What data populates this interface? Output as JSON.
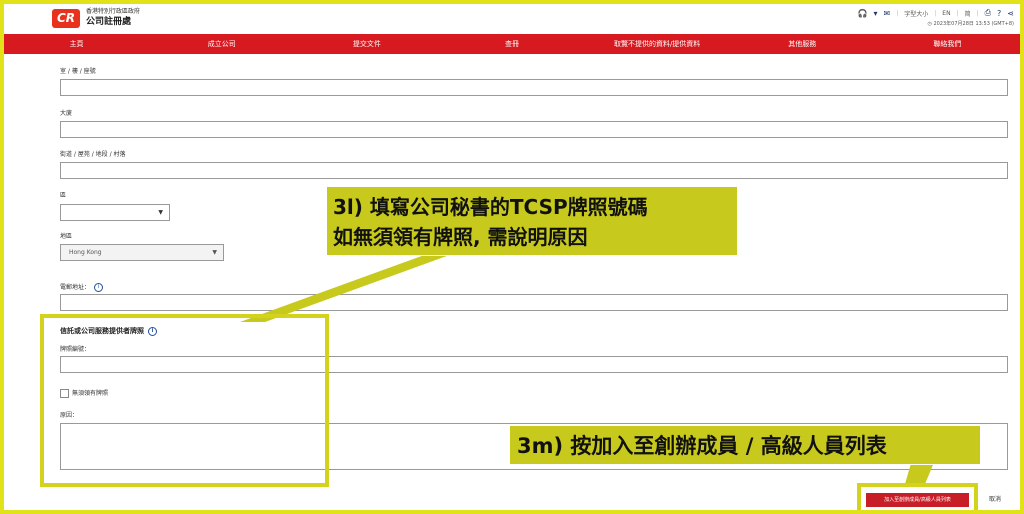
{
  "header": {
    "logo_text": "CR",
    "agency_line1": "香港特別行政區政府",
    "agency_line2": "公司註冊處",
    "font_size_label": "字型大小",
    "lang_en": "EN",
    "lang_sc": "简",
    "timestamp": "2023年07月28日 13:53 (GMT+8)",
    "icons": [
      "headset-icon",
      "cart-icon",
      "email-icon",
      "print-icon",
      "help-icon",
      "share-icon"
    ]
  },
  "nav": {
    "items": [
      "主頁",
      "成立公司",
      "提交文件",
      "查冊",
      "取覽不提供的資料/提供資料",
      "其他服務",
      "聯絡我們"
    ]
  },
  "form": {
    "address_room_label": "室 / 樓 / 座號",
    "building_label": "大廈",
    "street_label": "街道 / 屋苑 / 地段 / 村落",
    "district_label": "區",
    "region_label": "地區",
    "region_value": "Hong Kong",
    "email_label": "電郵地址：",
    "tcsp_title": "信託或公司服務提供者牌照",
    "licence_no_label": "牌照編號：",
    "no_licence_label": "無須領有牌照",
    "reason_label": "原因："
  },
  "callouts": {
    "c1_line1": "3l) 填寫公司秘書的TCSP牌照號碼",
    "c1_line2": "如無須領有牌照, 需說明原因",
    "c2": "3m) 按加入至創辦成員 / 高級人員列表"
  },
  "actions": {
    "add_button": "加入至創辦成員/高級人員列表",
    "cancel_button": "取消"
  },
  "colors": {
    "nav_red": "#d71920",
    "callout_yellow": "#c7c91c",
    "frame_yellow": "#e2e21a",
    "button_red": "#c81e28"
  }
}
